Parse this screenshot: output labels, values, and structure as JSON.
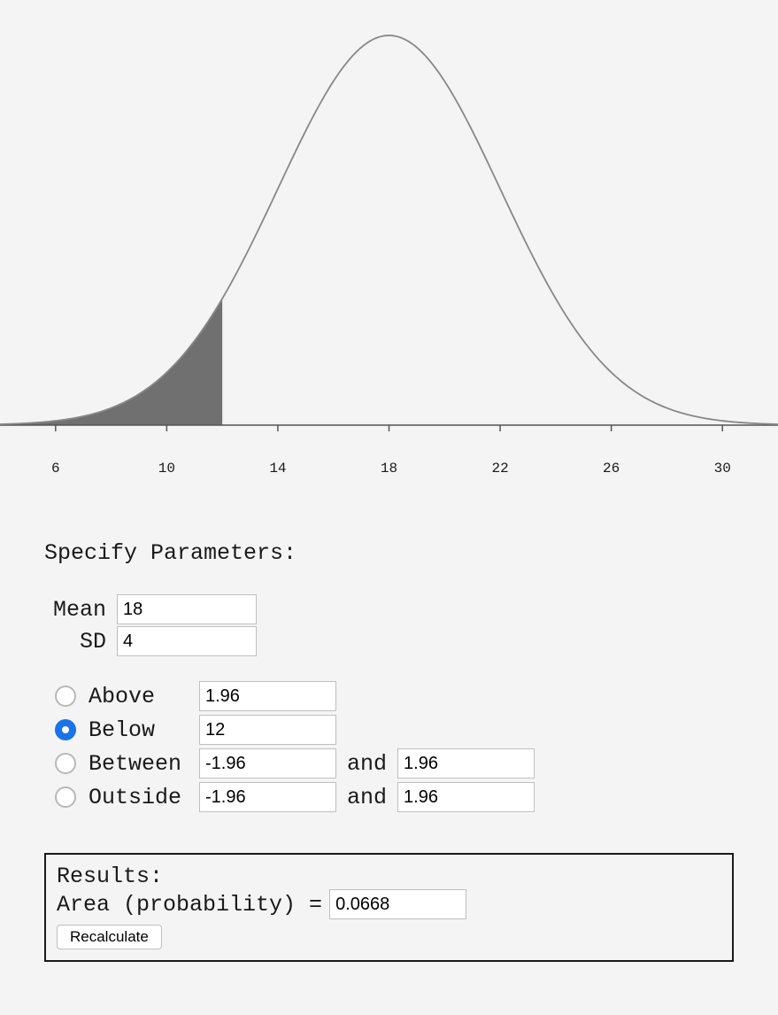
{
  "chart_data": {
    "type": "area",
    "distribution": "normal",
    "mean": 18,
    "sd": 4,
    "x_range": [
      4,
      32
    ],
    "x_ticks": [
      6,
      10,
      14,
      18,
      22,
      26,
      30
    ],
    "shaded_region": {
      "kind": "below",
      "upper": 12
    },
    "shaded_area": 0.0668,
    "curve_color": "#888888",
    "shade_color": "#707070"
  },
  "form": {
    "heading": "Specify Parameters:",
    "mean_label": "Mean",
    "mean_value": "18",
    "sd_label": "SD",
    "sd_value": "4",
    "options": {
      "above": {
        "label": "Above",
        "value": "1.96",
        "selected": false
      },
      "below": {
        "label": "Below",
        "value": "12",
        "selected": true
      },
      "between": {
        "label": "Between",
        "low": "-1.96",
        "and": "and",
        "high": "1.96",
        "selected": false
      },
      "outside": {
        "label": "Outside",
        "low": "-1.96",
        "and": "and",
        "high": "1.96",
        "selected": false
      }
    }
  },
  "results": {
    "heading": "Results:",
    "area_label": "Area (probability) =",
    "area_value": "0.0668",
    "recalculate": "Recalculate"
  }
}
